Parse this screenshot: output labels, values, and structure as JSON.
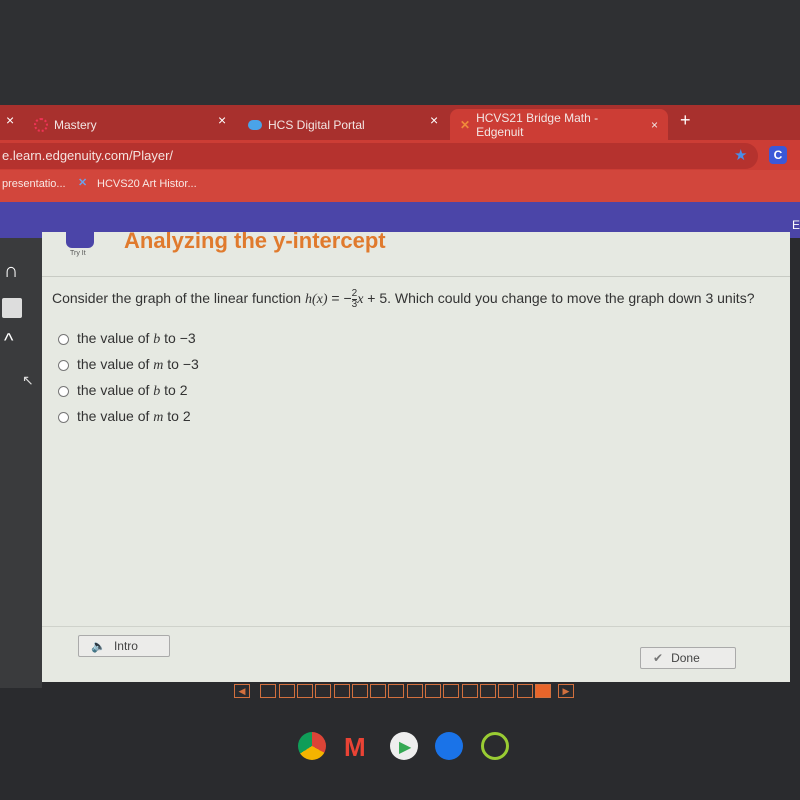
{
  "browser": {
    "tabs": [
      {
        "label": "Mastery"
      },
      {
        "label": "HCS Digital Portal"
      },
      {
        "label": "HCVS21 Bridge Math - Edgenuit",
        "active": true
      }
    ],
    "new_tab": "+",
    "close": "×",
    "url": "e.learn.edgenuity.com/Player/",
    "profile": "C",
    "bookmarks": [
      {
        "label": "presentatio..."
      },
      {
        "label": "HCVS20 Art Histor..."
      }
    ],
    "edge_letter": "E"
  },
  "lesson": {
    "title": "Analyzing the y-intercept",
    "tab_label": "Try It"
  },
  "question": {
    "prefix": "Consider the graph of the linear function ",
    "func": "h(x)",
    "eq": " = −",
    "num": "2",
    "den": "3",
    "var": "x",
    "suffix": " + 5. Which could you change to move the graph down 3 units?",
    "options": [
      {
        "pre": "the value of ",
        "v": "b",
        "post": " to −3"
      },
      {
        "pre": "the value of ",
        "v": "m",
        "post": " to −3"
      },
      {
        "pre": "the value of ",
        "v": "b",
        "post": " to 2"
      },
      {
        "pre": "the value of ",
        "v": "m",
        "post": " to 2"
      }
    ]
  },
  "footer": {
    "intro": "Intro",
    "done": "Done",
    "pages_total": 16,
    "current_page": 16
  },
  "colors": {
    "accent": "#e07a2d",
    "tabbar": "#a8302d",
    "header": "#4b45a8"
  }
}
